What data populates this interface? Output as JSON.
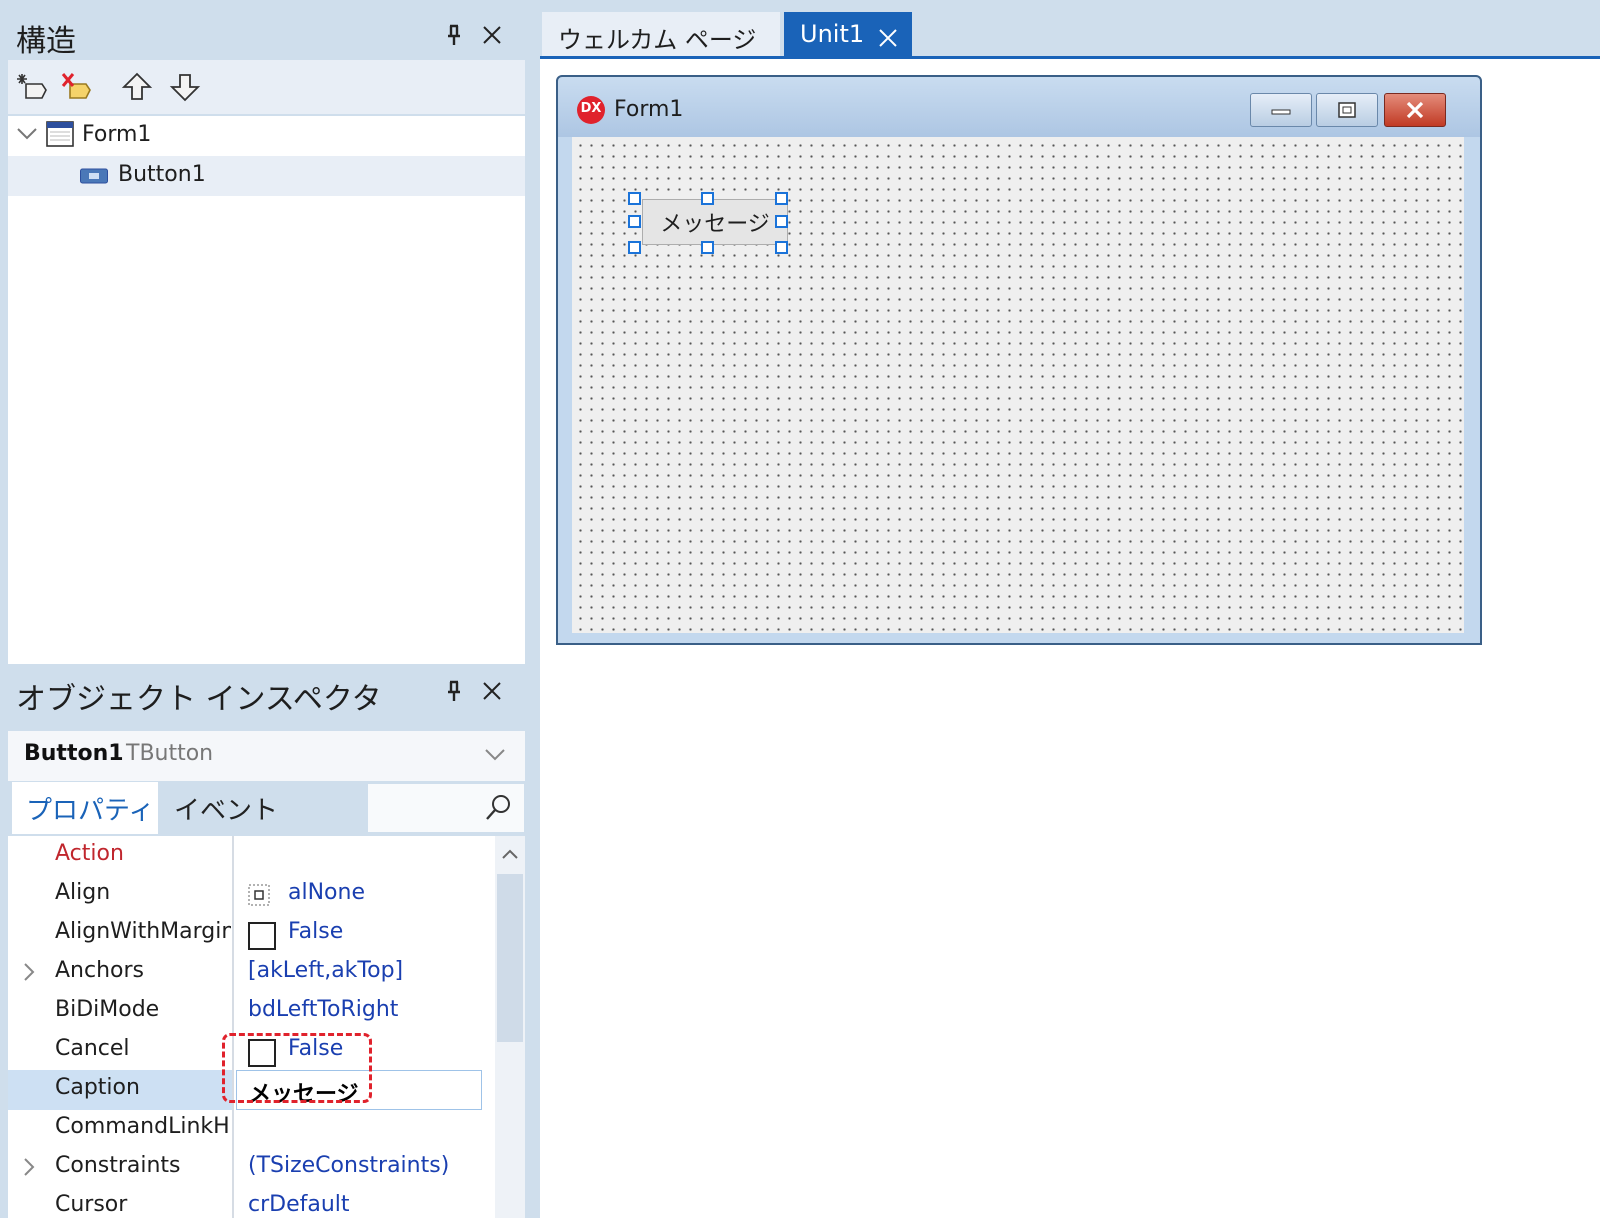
{
  "structure_panel": {
    "title": "構造",
    "pin_icon": "pin-icon",
    "close_icon": "close-icon",
    "toolbar_icons": [
      "new-item-icon",
      "delete-item-icon",
      "move-up-icon",
      "move-down-icon"
    ],
    "tree": [
      {
        "label": "Form1",
        "icon": "form-icon",
        "expanded": true
      },
      {
        "label": "Button1",
        "icon": "button-component-icon",
        "selected": true
      }
    ]
  },
  "inspector": {
    "title": "オブジェクト インスペクタ",
    "object_name": "Button1",
    "object_type": "TButton",
    "tabs": {
      "properties": "プロパティ",
      "events": "イベント"
    },
    "properties": [
      {
        "name": "Action",
        "value": ""
      },
      {
        "name": "Align",
        "value": "alNone"
      },
      {
        "name": "AlignWithMargins",
        "value": "False"
      },
      {
        "name": "Anchors",
        "value": "[akLeft,akTop]"
      },
      {
        "name": "BiDiMode",
        "value": "bdLeftToRight"
      },
      {
        "name": "Cancel",
        "value": "False"
      },
      {
        "name": "Caption",
        "value": "メッセージ"
      },
      {
        "name": "CommandLinkHint",
        "value": ""
      },
      {
        "name": "Constraints",
        "value": "(TSizeConstraints)"
      },
      {
        "name": "Cursor",
        "value": "crDefault"
      }
    ]
  },
  "editor_tabs": {
    "welcome": "ウェルカム ページ",
    "unit1": "Unit1"
  },
  "form": {
    "title": "Form1",
    "logo": "DX",
    "button_caption": "メッセージ"
  },
  "colors": {
    "panel_bg": "#cfdeec",
    "accent": "#1a63b8",
    "property_value": "#1a3fb0",
    "highlight_border": "#e0222c"
  }
}
